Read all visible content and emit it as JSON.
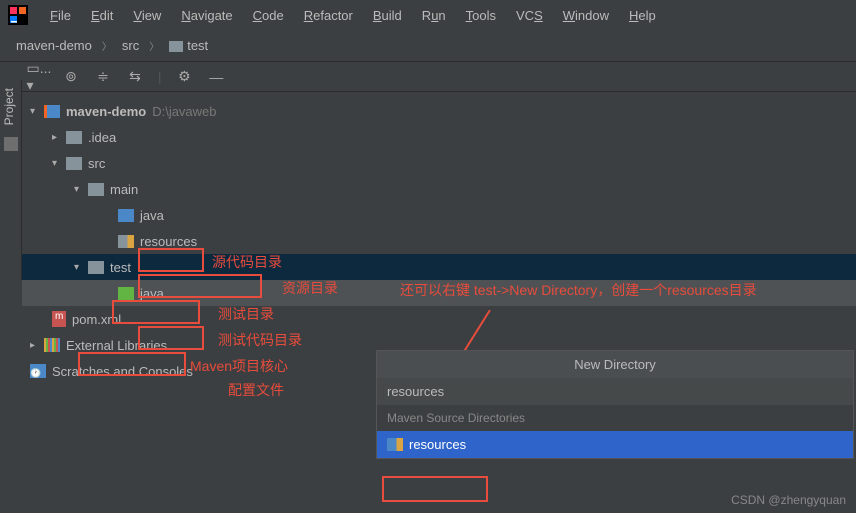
{
  "menu": {
    "items": [
      "File",
      "Edit",
      "View",
      "Navigate",
      "Code",
      "Refactor",
      "Build",
      "Run",
      "Tools",
      "VCS",
      "Window",
      "Help"
    ]
  },
  "breadcrumb": {
    "project": "maven-demo",
    "folder1": "src",
    "folder2": "test"
  },
  "sidebar": {
    "label": "Project"
  },
  "tree": {
    "root": "maven-demo",
    "root_path": "D:\\javaweb",
    "idea": ".idea",
    "src": "src",
    "main": "main",
    "java": "java",
    "resources": "resources",
    "test": "test",
    "test_java": "java",
    "pom": "pom.xml",
    "ext_lib": "External Libraries",
    "scratch": "Scratches and Consoles"
  },
  "labels": {
    "src_dir": "源代码目录",
    "res_dir": "资源目录",
    "test_dir": "测试目录",
    "test_code": "测试代码目录",
    "maven_core": "Maven项目核心",
    "config": "配置文件",
    "hint": "还可以右键 test->New Directory，创建一个resources目录"
  },
  "popup": {
    "title": "New Directory",
    "input_value": "resources",
    "section": "Maven Source Directories",
    "suggestion": "resources"
  },
  "watermark": "CSDN @zhengyquan"
}
